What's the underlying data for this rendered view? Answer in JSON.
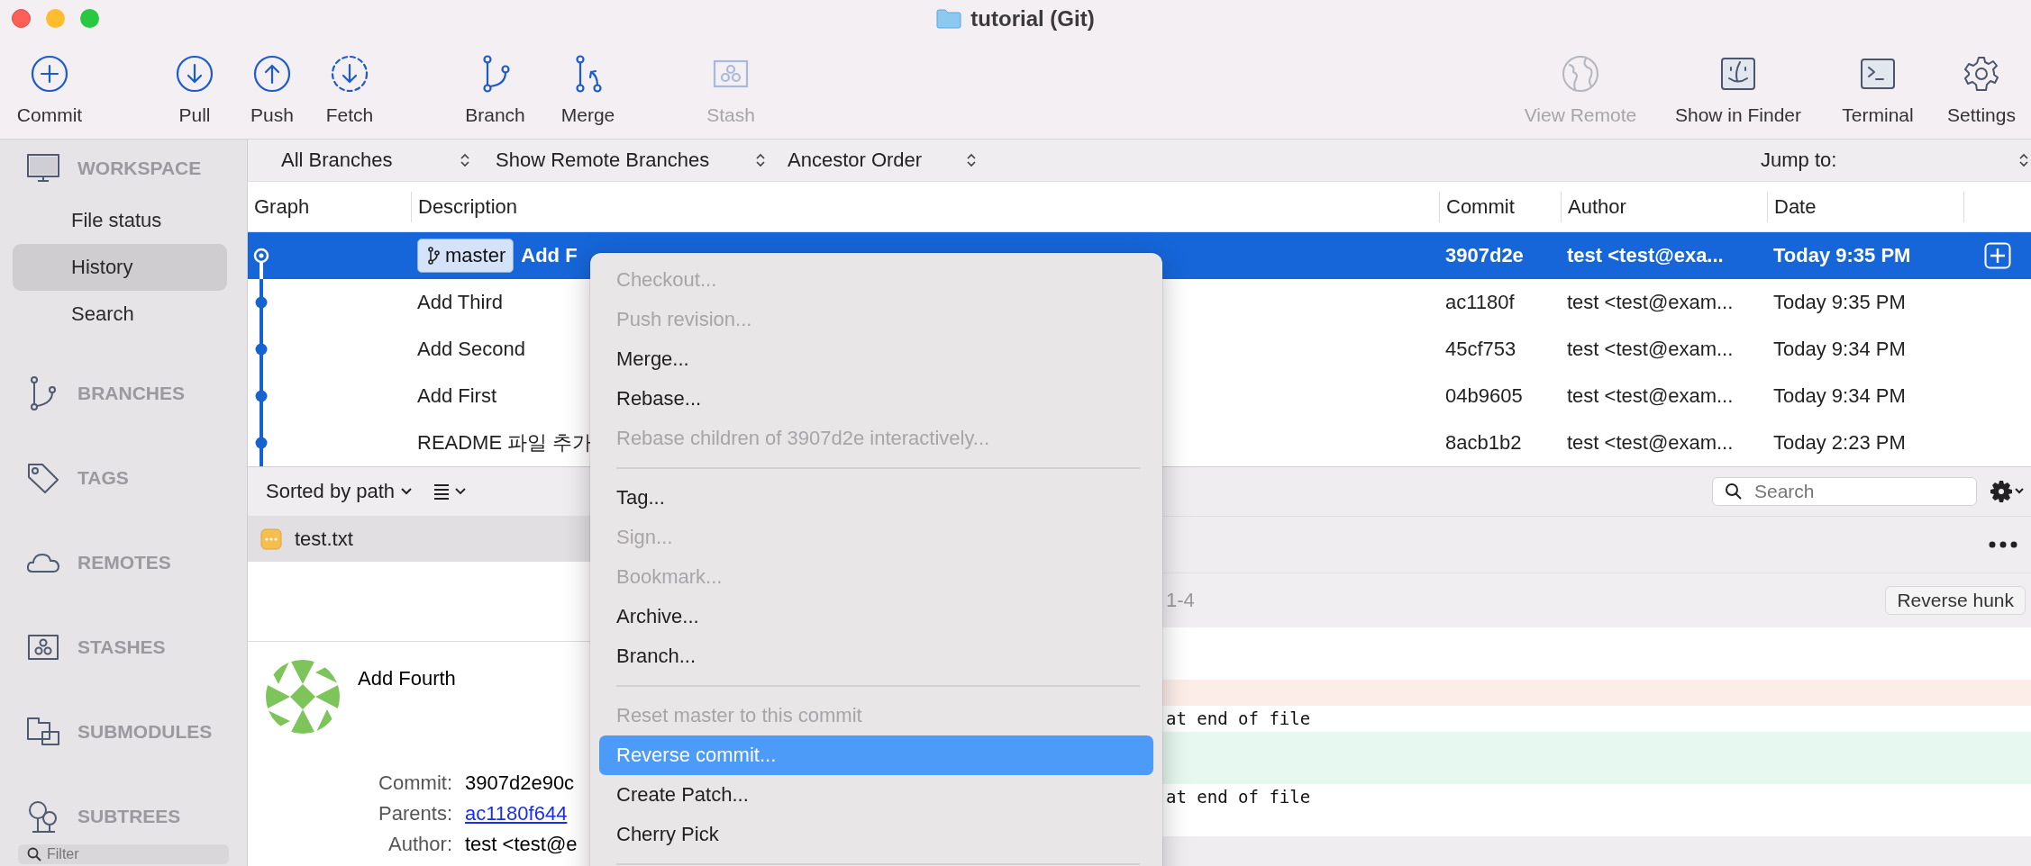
{
  "window": {
    "title": "tutorial (Git)"
  },
  "toolbar": {
    "groups": [
      [
        {
          "label": "Commit",
          "disabled": false
        }
      ],
      [
        {
          "label": "Pull",
          "disabled": false
        },
        {
          "label": "Push",
          "disabled": false
        },
        {
          "label": "Fetch",
          "disabled": false
        }
      ],
      [
        {
          "label": "Branch",
          "disabled": false
        },
        {
          "label": "Merge",
          "disabled": false
        }
      ],
      [
        {
          "label": "Stash",
          "disabled": true
        }
      ]
    ],
    "right": [
      {
        "label": "View Remote",
        "disabled": true
      },
      {
        "label": "Show in Finder",
        "disabled": false
      },
      {
        "label": "Terminal",
        "disabled": false
      },
      {
        "label": "Settings",
        "disabled": false
      }
    ]
  },
  "sidebar": {
    "sections": [
      {
        "title": "WORKSPACE",
        "items": [
          {
            "label": "File status",
            "selected": false
          },
          {
            "label": "History",
            "selected": true
          },
          {
            "label": "Search",
            "selected": false
          }
        ]
      },
      {
        "title": "BRANCHES"
      },
      {
        "title": "TAGS"
      },
      {
        "title": "REMOTES"
      },
      {
        "title": "STASHES"
      },
      {
        "title": "SUBMODULES"
      },
      {
        "title": "SUBTREES"
      }
    ],
    "filter": {
      "placeholder": "Filter"
    }
  },
  "filter_bar": {
    "selects": [
      "All Branches",
      "Show Remote Branches",
      "Ancestor Order"
    ],
    "jump_to": "Jump to:"
  },
  "table": {
    "columns": [
      "Graph",
      "Description",
      "Commit",
      "Author",
      "Date"
    ],
    "rows": [
      {
        "branch": "master",
        "description": "Add F",
        "commit": "3907d2e",
        "author": "test <test@exa...",
        "date": "Today 9:35 PM",
        "selected": true
      },
      {
        "description": "Add Third",
        "commit": "ac1180f",
        "author": "test <test@exam...",
        "date": "Today 9:35 PM",
        "selected": false
      },
      {
        "description": "Add Second",
        "commit": "45cf753",
        "author": "test <test@exam...",
        "date": "Today 9:34 PM",
        "selected": false
      },
      {
        "description": "Add First",
        "commit": "04b9605",
        "author": "test <test@exam...",
        "date": "Today 9:34 PM",
        "selected": false
      },
      {
        "description": "README 파일 추가",
        "commit": "8acb1b2",
        "author": "test <test@exam...",
        "date": "Today 2:23 PM",
        "selected": false
      }
    ]
  },
  "files": {
    "sort": "Sorted by path",
    "search": {
      "placeholder": "Search"
    },
    "items": [
      {
        "name": "test.txt",
        "selected": true
      }
    ]
  },
  "diff": {
    "hunk": "1-4",
    "button": "Reverse hunk",
    "lines": [
      {
        "kind": "context"
      },
      {
        "kind": "context"
      },
      {
        "kind": "removed"
      },
      {
        "kind": "context",
        "text": "at end of file"
      },
      {
        "kind": "added"
      },
      {
        "kind": "added"
      },
      {
        "kind": "context",
        "text": "at end of file"
      },
      {
        "kind": "context"
      }
    ]
  },
  "details": {
    "subject": "Add Fourth",
    "fields": [
      {
        "label": "Commit:",
        "value": "3907d2e90c",
        "kind": "text"
      },
      {
        "label": "Parents:",
        "value": "ac1180f644",
        "kind": "link"
      },
      {
        "label": "Author:",
        "value": "test <test@e",
        "kind": "text"
      }
    ]
  },
  "context_menu": [
    {
      "kind": "item",
      "label": "Checkout...",
      "disabled": true,
      "selected": false
    },
    {
      "kind": "item",
      "label": "Push revision...",
      "disabled": true,
      "selected": false
    },
    {
      "kind": "item",
      "label": "Merge...",
      "disabled": false,
      "selected": false
    },
    {
      "kind": "item",
      "label": "Rebase...",
      "disabled": false,
      "selected": false
    },
    {
      "kind": "item",
      "label": "Rebase children of 3907d2e interactively...",
      "disabled": true,
      "selected": false
    },
    {
      "kind": "separator"
    },
    {
      "kind": "item",
      "label": "Tag...",
      "disabled": false,
      "selected": false
    },
    {
      "kind": "item",
      "label": "Sign...",
      "disabled": true,
      "selected": false
    },
    {
      "kind": "item",
      "label": "Bookmark...",
      "disabled": true,
      "selected": false
    },
    {
      "kind": "item",
      "label": "Archive...",
      "disabled": false,
      "selected": false
    },
    {
      "kind": "item",
      "label": "Branch...",
      "disabled": false,
      "selected": false
    },
    {
      "kind": "separator"
    },
    {
      "kind": "item",
      "label": "Reset master to this commit",
      "disabled": true,
      "selected": false
    },
    {
      "kind": "item",
      "label": "Reverse commit...",
      "disabled": false,
      "selected": true
    },
    {
      "kind": "item",
      "label": "Create Patch...",
      "disabled": false,
      "selected": false
    },
    {
      "kind": "item",
      "label": "Cherry Pick",
      "disabled": false,
      "selected": false
    },
    {
      "kind": "separator"
    }
  ]
}
